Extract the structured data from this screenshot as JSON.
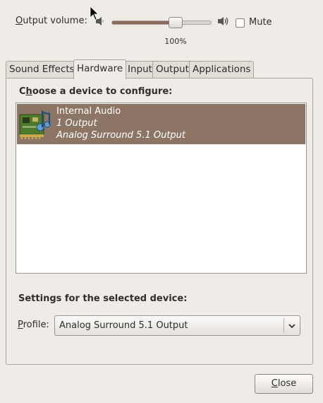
{
  "volume": {
    "label": "Output volume:",
    "value_text": "100%",
    "level": 0.64,
    "mute_label": "Mute",
    "mute_checked": false,
    "low_icon": "speaker-low-icon",
    "high_icon": "speaker-high-icon"
  },
  "tabs": [
    {
      "label": "Sound Effects",
      "active": false
    },
    {
      "label": "Hardware",
      "active": true
    },
    {
      "label": "Input",
      "active": false
    },
    {
      "label": "Output",
      "active": false
    },
    {
      "label": "Applications",
      "active": false
    }
  ],
  "hardware": {
    "choose_title": "Choose a device to configure:",
    "devices": [
      {
        "name": "Internal Audio",
        "outputs": "1 Output",
        "profile": "Analog Surround 5.1 Output",
        "icon": "sound-card-icon",
        "selected": true
      }
    ],
    "settings_title": "Settings for the selected device:",
    "profile_label": "Profile:",
    "profile_value": "Analog Surround 5.1 Output"
  },
  "close_label": "Close",
  "colors": {
    "selection": "#8c7565",
    "background": "#efebe7"
  }
}
